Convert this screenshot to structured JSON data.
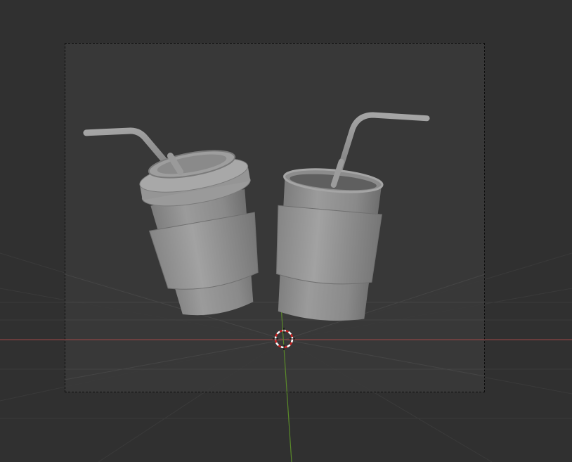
{
  "app": "Blender",
  "view": {
    "background_color": "#303030",
    "camera_frame_color": "#3a3a3a",
    "grid_line_color": "#3a3a3a",
    "x_axis_color": "#a14848",
    "y_axis_color": "#5a8a2a",
    "cursor_ring_colors": [
      "#cc2222",
      "#ffffff"
    ]
  },
  "scene": {
    "objects": [
      "coffee-cup-with-lid",
      "cup-with-straw"
    ],
    "material_color": "#8d8d8d"
  }
}
